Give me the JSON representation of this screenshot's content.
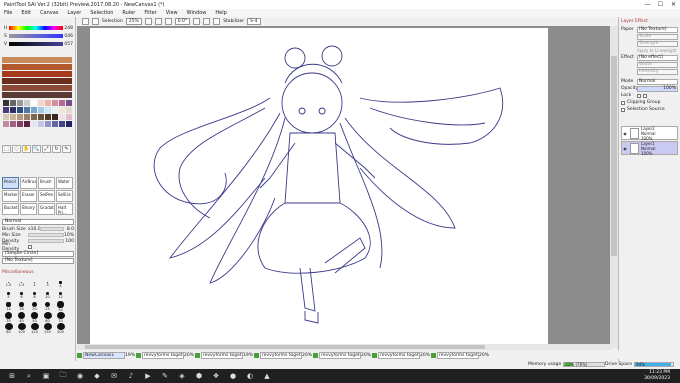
{
  "window": {
    "title": "PaintTool SAI Ver.2 (32bit) Preview.2017.08.20 - NewCanvas1 (*)",
    "controls": [
      "—",
      "☐",
      "✕"
    ]
  },
  "menu": [
    "File",
    "Edit",
    "Canvas",
    "Layer",
    "Selection",
    "Ruler",
    "Filter",
    "View",
    "Window",
    "Help"
  ],
  "toolbar": {
    "selection_label": "Selection",
    "zoom": "25%",
    "rotation": "0.0°",
    "stabilizer_label": "Stabilizer",
    "stabilizer_value": "S-4"
  },
  "color": {
    "h": {
      "label": "H",
      "value": "248"
    },
    "s": {
      "label": "S",
      "value": "046"
    },
    "v": {
      "label": "V",
      "value": "057"
    }
  },
  "mixer_colors": [
    "#c98a5a",
    "#b4582d",
    "#a83a1e",
    "#6b2d1e",
    "#8a4a35",
    "#5a3a35"
  ],
  "swatch_colors": [
    "#333",
    "#666",
    "#999",
    "#ccc",
    "#fff",
    "#f6d5c8",
    "#e8b4a8",
    "#d98ca0",
    "#b56b8f",
    "#7a4f8a",
    "#4d3a7d",
    "#2f2f66",
    "#2f4d7d",
    "#4d7aa6",
    "#7aa6c9",
    "#a6c9e6",
    "#c9e6f2",
    "#e6f2f2",
    "#f2e6d9",
    "#e6d9c9",
    "#d9c9b3",
    "#c9b399",
    "#b39980",
    "#998066",
    "#806650",
    "#66503a",
    "#503a2a",
    "#3a2a1e",
    "#f0e0e8",
    "#e0c0d0",
    "#c08aa0",
    "#a06080",
    "#804060",
    "#602040",
    "#e4e4f4",
    "#c4c4e4",
    "#9494c4",
    "#6464a4",
    "#444484",
    "#242464"
  ],
  "tools": [
    "⬚",
    "◌",
    "✋",
    "🔍",
    "⤢",
    "↻",
    "✎"
  ],
  "brushes": [
    {
      "name": "Pencil",
      "selected": true
    },
    {
      "name": "AirBrush",
      "selected": false
    },
    {
      "name": "Brush",
      "selected": false
    },
    {
      "name": "Water",
      "selected": false
    },
    {
      "name": "Marker",
      "selected": false
    },
    {
      "name": "Eraser",
      "selected": false
    },
    {
      "name": "SelPen",
      "selected": false
    },
    {
      "name": "SelEra",
      "selected": false
    },
    {
      "name": "Bucket",
      "selected": false
    },
    {
      "name": "Binary",
      "selected": false
    },
    {
      "name": "Gradati...",
      "selected": false
    },
    {
      "name": "Halt Pri...",
      "selected": false
    }
  ],
  "brush_props": {
    "mode": "Normal",
    "size_label": "Brush Size",
    "size_mult": "x10.0",
    "size_value": "8.0",
    "min_size_label": "Min Size",
    "min_size_value": "10%",
    "density_label": "Density",
    "density_value": "100",
    "min_density_label": "Min Density",
    "shape": "[Simple Circle]",
    "texture": "[No Texture]"
  },
  "misc_label": "Miscellaneous",
  "brush_sizes": [
    "1.0",
    "1.5",
    "2",
    "3",
    "4",
    "5",
    "6",
    "8",
    "10",
    "12",
    "14",
    "16",
    "20",
    "25",
    "30",
    "35",
    "40",
    "50",
    "60",
    "70",
    "80",
    "100",
    "120",
    "150",
    "200"
  ],
  "right": {
    "heading": "Layer Effect",
    "paper_label": "Paper",
    "paper_value": "[No Texture]",
    "scale_label": "Scale",
    "strength_label": "Strength",
    "apply_label": "Apply to Lineweight",
    "effect_label": "Effect",
    "effect_value": "[No effect]",
    "width_label": "Width",
    "intensity_label": "Intensity",
    "mode_label": "Mode",
    "mode_value": "Normal",
    "opacity_label": "Opacity",
    "opacity_value": "100%",
    "lock_label": "Lock",
    "clipping_label": "Clipping Group",
    "selection_source_label": "Selection Source",
    "layers": [
      {
        "name": "Layer2",
        "mode": "Normal",
        "opacity": "100%",
        "selected": false
      },
      {
        "name": "Layer1",
        "mode": "Normal",
        "opacity": "100%",
        "selected": true
      }
    ]
  },
  "canvas_tabs": [
    {
      "name": "NewCanvas1",
      "zoom": "19%",
      "active": true
    },
    {
      "name": "revvyforms toget...",
      "zoom": "20%",
      "active": false
    },
    {
      "name": "revvyforms toget...",
      "zoom": "19%",
      "active": false
    },
    {
      "name": "revvyforms toget...",
      "zoom": "20%",
      "active": false
    },
    {
      "name": "revvyforms toget...",
      "zoom": "20%",
      "active": false
    },
    {
      "name": "revvyforms toget...",
      "zoom": "20%",
      "active": false
    },
    {
      "name": "revvyforms toget...",
      "zoom": "20%",
      "active": false
    }
  ],
  "memory": {
    "label": "Memory usage",
    "value": "22% (76%)",
    "fill": 0.22
  },
  "drive": {
    "label": "Drive Space",
    "value": "94%",
    "fill": 0.94
  },
  "taskbar": {
    "icons": [
      "⊞",
      "⌕",
      "▣",
      "🗀",
      "◉",
      "◆",
      "✉",
      "♪",
      "▶",
      "✎",
      "◈",
      "⬢",
      "❖",
      "●",
      "◐",
      "▲"
    ],
    "time": "11:23 PM",
    "date": "30/09/2023"
  }
}
